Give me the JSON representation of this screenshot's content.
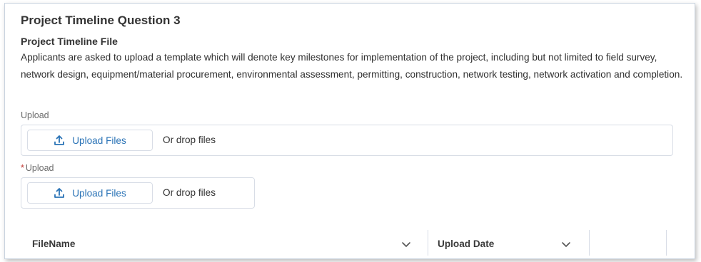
{
  "section": {
    "title": "Project Timeline Question 3",
    "subtitle": "Project Timeline File",
    "description": "Applicants are asked to upload a template which will denote key milestones for implementation of the project, including but not limited to field survey, network design, equipment/material procurement, environmental assessment, permitting, construction, network testing, network activation and completion."
  },
  "upload_fields": [
    {
      "label": "Upload",
      "required": false,
      "button_label": "Upload Files",
      "drop_text": "Or drop files",
      "icon": "upload-icon"
    },
    {
      "label": "Upload",
      "required": true,
      "required_marker": "*",
      "button_label": "Upload Files",
      "drop_text": "Or drop files",
      "icon": "upload-icon"
    }
  ],
  "table": {
    "columns": [
      {
        "label": "FileName",
        "icon": "chevron-down-icon"
      },
      {
        "label": "Upload Date",
        "icon": "chevron-down-icon"
      }
    ]
  },
  "colors": {
    "link_blue": "#2a73b6",
    "required_red": "#c23934",
    "border": "#d8dde6"
  }
}
